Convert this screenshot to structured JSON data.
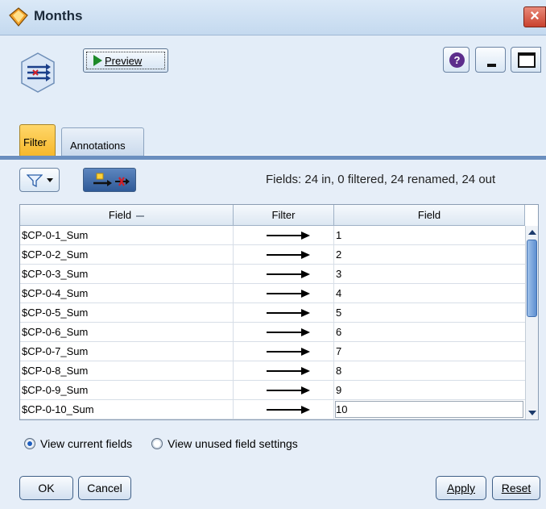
{
  "window": {
    "title": "Months"
  },
  "toolbar": {
    "preview_label": "Preview"
  },
  "tabs": [
    {
      "label": "Filter",
      "active": true
    },
    {
      "label": "Annotations",
      "active": false
    }
  ],
  "filter_panel": {
    "fields_summary": "Fields: 24 in, 0 filtered, 24 renamed, 24 out"
  },
  "table": {
    "columns": [
      "Field",
      "Filter",
      "Field"
    ],
    "rows": [
      {
        "input_field": "$CP-0-1_Sum",
        "output_field": "1"
      },
      {
        "input_field": "$CP-0-2_Sum",
        "output_field": "2"
      },
      {
        "input_field": "$CP-0-3_Sum",
        "output_field": "3"
      },
      {
        "input_field": "$CP-0-4_Sum",
        "output_field": "4"
      },
      {
        "input_field": "$CP-0-5_Sum",
        "output_field": "5"
      },
      {
        "input_field": "$CP-0-6_Sum",
        "output_field": "6"
      },
      {
        "input_field": "$CP-0-7_Sum",
        "output_field": "7"
      },
      {
        "input_field": "$CP-0-8_Sum",
        "output_field": "8"
      },
      {
        "input_field": "$CP-0-9_Sum",
        "output_field": "9"
      },
      {
        "input_field": "$CP-0-10_Sum",
        "output_field": "10"
      }
    ]
  },
  "view_options": {
    "current_label": "View current fields",
    "unused_label": "View unused field settings",
    "selected": "current"
  },
  "buttons": {
    "ok": "OK",
    "cancel": "Cancel",
    "apply": "Apply",
    "reset": "Reset"
  },
  "colors": {
    "active_tab": "#f6b72a",
    "panel_bg": "#e6eef8",
    "accent_rule": "#6b8fbf"
  }
}
